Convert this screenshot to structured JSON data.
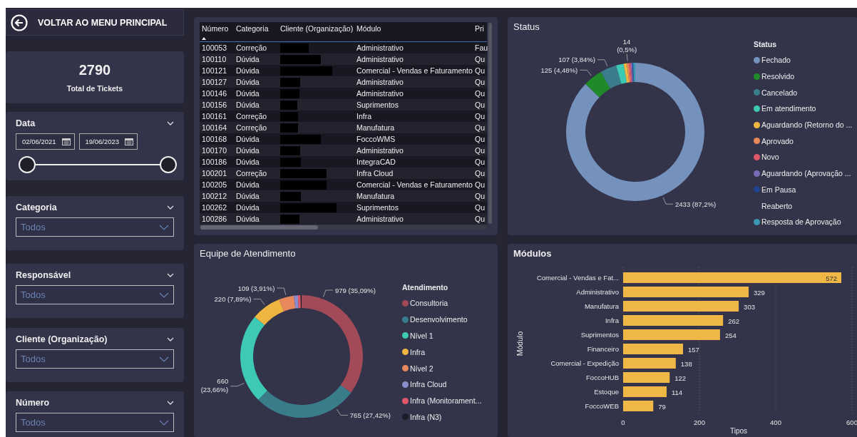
{
  "back_button": {
    "label": "VOLTAR AO MENU PRINCIPAL"
  },
  "total_card": {
    "value": "2790",
    "label": "Total de Tickets"
  },
  "date_filter": {
    "title": "Data",
    "start": "02/06/2021",
    "end": "19/06/2023",
    "start_thumb": {
      "level": 0
    },
    "end_thumb": {
      "level": 1
    }
  },
  "filters": [
    {
      "title": "Categoria",
      "value": "Todos"
    },
    {
      "title": "Responsável",
      "value": "Todos"
    },
    {
      "title": "Cliente (Organização)",
      "value": "Todos"
    },
    {
      "title": "Número",
      "value": "Todos"
    }
  ],
  "table": {
    "columns": [
      "Número",
      "Categoria",
      "Cliente (Organização)",
      "Módulo",
      "Pri"
    ],
    "rows": [
      {
        "numero": "100053",
        "categoria": "Correção",
        "redacted": true,
        "modulo": "Administrativo",
        "column_5": "Fau"
      },
      {
        "numero": "100110",
        "categoria": "Dúvida",
        "redacted": true,
        "modulo": "Administrativo",
        "column_5": "Qu"
      },
      {
        "numero": "100121",
        "categoria": "Dúvida",
        "redacted": true,
        "modulo": "Comercial - Vendas e Faturamento",
        "column_5": "Qu"
      },
      {
        "numero": "100127",
        "categoria": "Dúvida",
        "redacted": true,
        "modulo": "Administrativo",
        "column_5": "Qu"
      },
      {
        "numero": "100146",
        "categoria": "Dúvida",
        "redacted": true,
        "modulo": "Administrativo",
        "column_5": "Qu"
      },
      {
        "numero": "100156",
        "categoria": "Dúvida",
        "redacted": true,
        "modulo": "Suprimentos",
        "column_5": "Qu"
      },
      {
        "numero": "100161",
        "categoria": "Correção",
        "redacted": true,
        "modulo": "Infra",
        "column_5": "Qu"
      },
      {
        "numero": "100164",
        "categoria": "Correção",
        "redacted": true,
        "modulo": "Manufatura",
        "column_5": "Qu"
      },
      {
        "numero": "100168",
        "categoria": "Dúvida",
        "redacted": true,
        "modulo": "FoccoWMS",
        "column_5": "Qu"
      },
      {
        "numero": "100170",
        "categoria": "Dúvida",
        "redacted": true,
        "modulo": "Administrativo",
        "column_5": "Qu"
      },
      {
        "numero": "100186",
        "categoria": "Dúvida",
        "redacted": true,
        "modulo": "IntegraCAD",
        "column_5": "Qu"
      },
      {
        "numero": "100201",
        "categoria": "Correção",
        "redacted": true,
        "modulo": "Infra Cloud",
        "column_5": "Qu"
      },
      {
        "numero": "100205",
        "categoria": "Dúvida",
        "redacted": true,
        "modulo": "Comercial - Vendas e Faturamento",
        "column_5": "Qu"
      },
      {
        "numero": "100212",
        "categoria": "Dúvida",
        "redacted": true,
        "modulo": "Manufatura",
        "column_5": "Qu"
      },
      {
        "numero": "100262",
        "categoria": "Dúvida",
        "redacted": true,
        "modulo": "Suprimentos",
        "column_5": "Qu"
      },
      {
        "numero": "100286",
        "categoria": "Dúvida",
        "redacted": true,
        "modulo": "Administrativo",
        "column_5": "Qu"
      }
    ]
  },
  "status": {
    "title": "Status",
    "chart_data": {
      "type": "donut",
      "legend_title": "Status",
      "categories": [
        "Fechado",
        "Resolvido",
        "Cancelado",
        "Em atendimento",
        "Aguardando (Retorno do ...",
        "Aprovado",
        "Novo",
        "Aguardando (Aprovação ...",
        "Em Pausa",
        "Reaberto",
        "Resposta de Aprovação"
      ],
      "values": [
        2433,
        125,
        107,
        50,
        20,
        14,
        12,
        10,
        5,
        0,
        14
      ],
      "colors": [
        "#7592bd",
        "#208a2b",
        "#3b7d8c",
        "#3ec9b2",
        "#f0b743",
        "#e8885a",
        "#e0566b",
        "#7a6bb8",
        "#22448f",
        null,
        "#3a97b3"
      ],
      "value_labels": [
        "2433 (87,2%)",
        "125 (4,48%)",
        "107 (3,84%)",
        null,
        null,
        "14 (0,5%)",
        null,
        null,
        null,
        null,
        null
      ]
    }
  },
  "equipe": {
    "title": "Equipe de Atendimento",
    "chart_data": {
      "type": "donut",
      "legend_title": "Atendimento",
      "categories": [
        "Consultoria",
        "Desenvolvimento",
        "Nível 1",
        "Infra",
        "Nível 2",
        "Infra Cloud",
        "Infra (Monitorament...",
        "Infra (N3)"
      ],
      "values": [
        979,
        765,
        660,
        220,
        109,
        30,
        20,
        7
      ],
      "colors": [
        "#a34a58",
        "#3a7d8a",
        "#3ec9b4",
        "#eeb540",
        "#e7895a",
        "#8c8ccc",
        "#e0566b",
        "#1c1c28"
      ],
      "value_labels": [
        "979 (35,09%)",
        "765 (27,42%)",
        "660 (23,66%)",
        "220 (7,89%)",
        "109 (3,91%)",
        null,
        null,
        null
      ]
    }
  },
  "modulos": {
    "title": "Módulos",
    "chart_data": {
      "type": "bar",
      "orientation": "horizontal",
      "ylabel": "Módulo",
      "xlabel": "Tipos",
      "categories": [
        "Comercial - Vendas e Fat...",
        "Administrativo",
        "Manufatura",
        "Infra",
        "Suprimentos",
        "Financeiro",
        "Comercial - Expedição",
        "FoccoHUB",
        "Estoque",
        "FoccoWEB"
      ],
      "series": [
        {
          "color": "#efb745",
          "values": [
            572,
            329,
            303,
            262,
            254,
            157,
            138,
            122,
            114,
            79
          ]
        }
      ],
      "xlim": [
        0,
        600
      ],
      "xticks": [
        0,
        200,
        400,
        600
      ],
      "data_labels": true
    }
  }
}
